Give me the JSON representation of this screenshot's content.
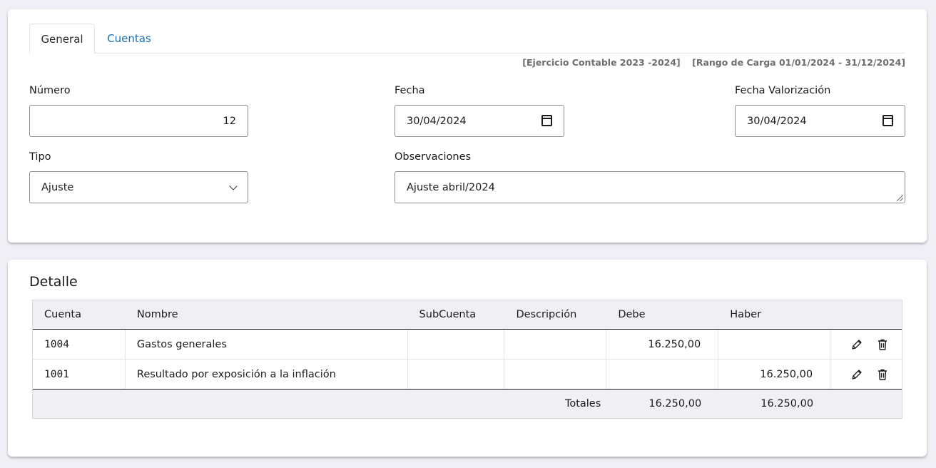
{
  "tabs": [
    {
      "label": "General",
      "active": true
    },
    {
      "label": "Cuentas",
      "active": false
    }
  ],
  "meta": {
    "ejercicio": "[Ejercicio Contable 2023 -2024]",
    "rango": "[Rango de Carga  01/01/2024  -  31/12/2024]"
  },
  "form": {
    "numero_label": "Número",
    "numero_value": "12",
    "fecha_label": "Fecha",
    "fecha_value": "30/04/2024",
    "fecha_val_label": "Fecha Valorización",
    "fecha_val_value": "30/04/2024",
    "tipo_label": "Tipo",
    "tipo_value": "Ajuste",
    "obs_label": "Observaciones",
    "obs_value": "Ajuste abril/2024"
  },
  "detalle": {
    "title": "Detalle",
    "columns": [
      "Cuenta",
      "Nombre",
      "SubCuenta",
      "Descripción",
      "Debe",
      "Haber"
    ],
    "rows": [
      {
        "cuenta": "1004",
        "nombre": "Gastos generales",
        "subcuenta": "",
        "descripcion": "",
        "debe": "16.250,00",
        "haber": ""
      },
      {
        "cuenta": "1001",
        "nombre": "Resultado por exposición a la inflación",
        "subcuenta": "",
        "descripcion": "",
        "debe": "",
        "haber": "16.250,00"
      }
    ],
    "totales_label": "Totales",
    "total_debe": "16.250,00",
    "total_haber": "16.250,00"
  },
  "icons": {
    "edit": "pencil-icon",
    "delete": "trash-icon",
    "date": "calendar-icon",
    "select": "chevron-down-icon"
  },
  "colors": {
    "tab_link": "#1a6fb8",
    "background": "#f0eff5",
    "table_header": "#efeff4"
  }
}
